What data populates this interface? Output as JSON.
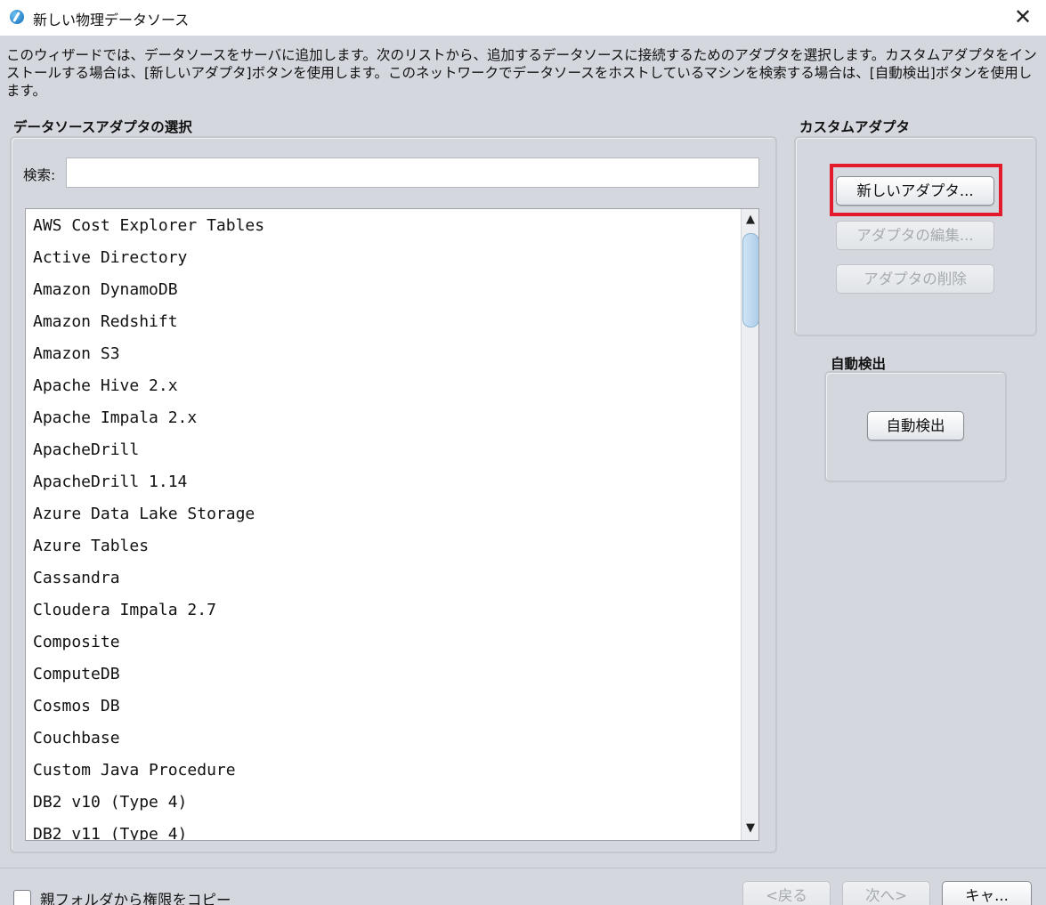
{
  "window": {
    "title": "新しい物理データソース",
    "app_icon": "app-logo-icon",
    "close_glyph": "✕"
  },
  "description": "このウィザードでは、データソースをサーバに追加します。次のリストから、追加するデータソースに接続するためのアダプタを選択します。カスタムアダプタをインストールする場合は、[新しいアダプタ]ボタンを使用します。このネットワークでデータソースをホストしているマシンを検索する場合は、[自動検出]ボタンを使用します。",
  "adapter_selection": {
    "label": "データソースアダプタの選択",
    "search_label": "検索:",
    "search_value": "",
    "items": [
      "AWS Cost Explorer Tables",
      "Active Directory",
      "Amazon DynamoDB",
      "Amazon Redshift",
      "Amazon S3",
      "Apache Hive 2.x",
      "Apache Impala 2.x",
      "ApacheDrill",
      "ApacheDrill 1.14",
      "Azure Data Lake Storage",
      "Azure Tables",
      "Cassandra",
      "Cloudera Impala 2.7",
      "Composite",
      "ComputeDB",
      "Cosmos DB",
      "Couchbase",
      "Custom Java Procedure",
      "DB2 v10 (Type 4)",
      "DB2 v11 (Type 4)"
    ],
    "scroll_up_glyph": "▲",
    "scroll_down_glyph": "▼"
  },
  "custom_adapter": {
    "label": "カスタムアダプタ",
    "new_button": "新しいアダプタ...",
    "edit_button": "アダプタの編集...",
    "delete_button": "アダプタの削除",
    "highlight_color": "#e21a2c"
  },
  "auto_detect": {
    "label": "自動検出",
    "button": "自動検出"
  },
  "footer": {
    "checkbox_label": "親フォルダから権限をコピー",
    "checkbox_checked": false,
    "back_button": "<戻る",
    "next_button": "次へ>",
    "cancel_button": "キャ..."
  }
}
